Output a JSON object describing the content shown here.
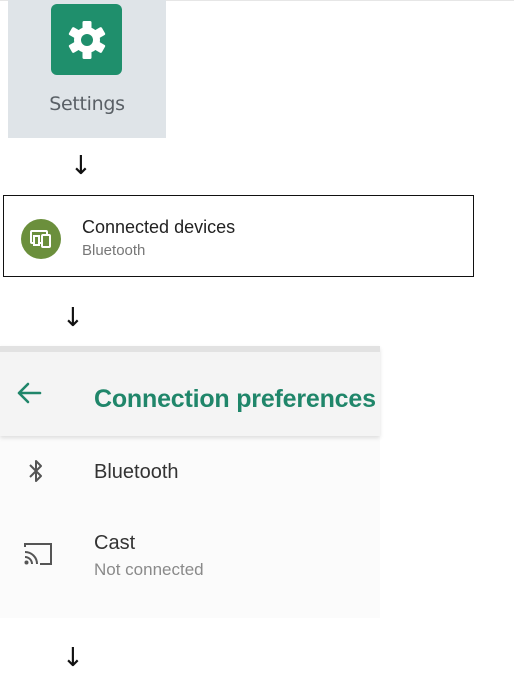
{
  "settings_tile": {
    "label": "Settings",
    "icon": "gear-icon",
    "icon_color": "#1f8f6c"
  },
  "connected_devices": {
    "title": "Connected devices",
    "subtitle": "Bluetooth",
    "icon": "devices-icon",
    "icon_color": "#6b8f3c"
  },
  "connection_preferences": {
    "title": "Connection preferences",
    "back_icon": "back-arrow-icon",
    "accent_color": "#20866a",
    "items": [
      {
        "label": "Bluetooth",
        "icon": "bluetooth-icon"
      },
      {
        "label": "Cast",
        "subtitle": "Not connected",
        "icon": "cast-icon"
      }
    ]
  },
  "flow_arrows": [
    "↓",
    "↓",
    "↓"
  ]
}
